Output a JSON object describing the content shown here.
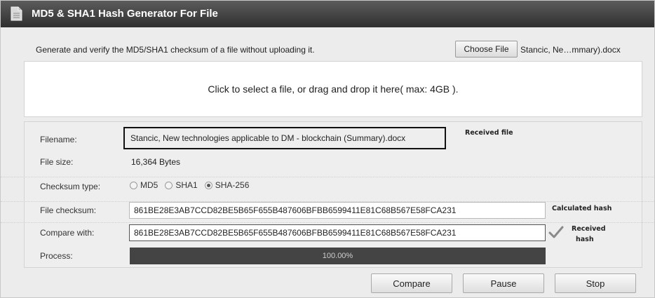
{
  "window": {
    "title": "MD5 & SHA1 Hash Generator For File",
    "icon": "document-icon"
  },
  "header": {
    "description": "Generate and verify the MD5/SHA1 checksum of a file without uploading it.",
    "choose_label": "Choose File",
    "chosen_name": "Stancic, Ne…mmary).docx"
  },
  "dropzone": {
    "text": "Click to select a file, or drag and drop it here( max: 4GB )."
  },
  "details": {
    "filename_label": "Filename:",
    "filename_value": "Stancic, New technologies applicable to DM - blockchain (Summary).docx",
    "filesize_label": "File size:",
    "filesize_value": "16,364 Bytes",
    "checksum_type_label": "Checksum type:",
    "checksum_options": [
      "MD5",
      "SHA1",
      "SHA-256"
    ],
    "checksum_selected": "SHA-256",
    "file_checksum_label": "File checksum:",
    "file_checksum_value": "861BE28E3AB7CCD82BE5B65F655B487606BFBB6599411E81C68B567E58FCA231",
    "compare_label": "Compare with:",
    "compare_value": "861BE28E3AB7CCD82BE5B65F655B487606BFBB6599411E81C68B567E58FCA231",
    "process_label": "Process:",
    "process_text": "100.00%",
    "process_fraction": 1.0
  },
  "annotations": {
    "received_file": "Received file",
    "calculated_hash": "Calculated hash",
    "received_hash_line1": "Received",
    "received_hash_line2": "hash"
  },
  "buttons": {
    "compare": "Compare",
    "pause": "Pause",
    "stop": "Stop"
  },
  "colors": {
    "titlebar": "#3a3a3a",
    "progress": "#4a4a4a",
    "check": "#7a7a7a"
  }
}
